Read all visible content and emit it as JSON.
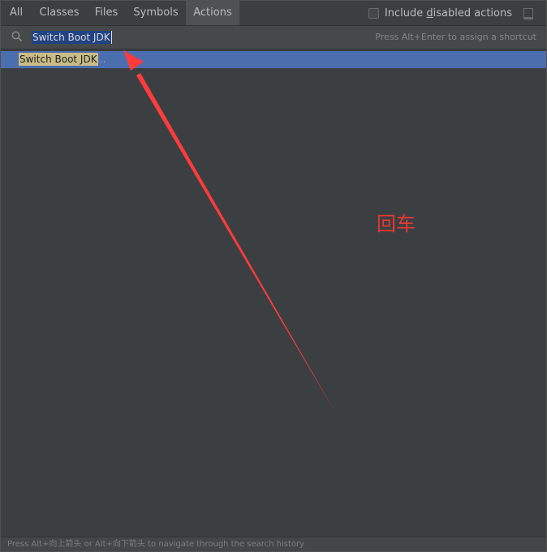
{
  "tabs": [
    {
      "label": "All"
    },
    {
      "label": "Classes"
    },
    {
      "label": "Files"
    },
    {
      "label": "Symbols"
    },
    {
      "label": "Actions",
      "active": true
    }
  ],
  "include_disabled": {
    "label_prefix": "Include ",
    "label_underlined": "d",
    "label_suffix": "isabled actions",
    "checked": false
  },
  "search": {
    "value": "Switch Boot JDK",
    "hint": "Press Alt+Enter to assign a shortcut",
    "icon": "search-icon"
  },
  "results": [
    {
      "label": "Switch Boot JDK",
      "trailing": "..."
    }
  ],
  "annotation": {
    "text": "回车",
    "color": "#e53935"
  },
  "footer": {
    "text": "Press Alt+向上箭头 or Alt+向下箭头 to navigate through the search history"
  },
  "colors": {
    "background": "#3c3f41",
    "selection": "#4b6eaf",
    "match_highlight": "#c9bd86",
    "arrow": "#ff3b3b"
  }
}
